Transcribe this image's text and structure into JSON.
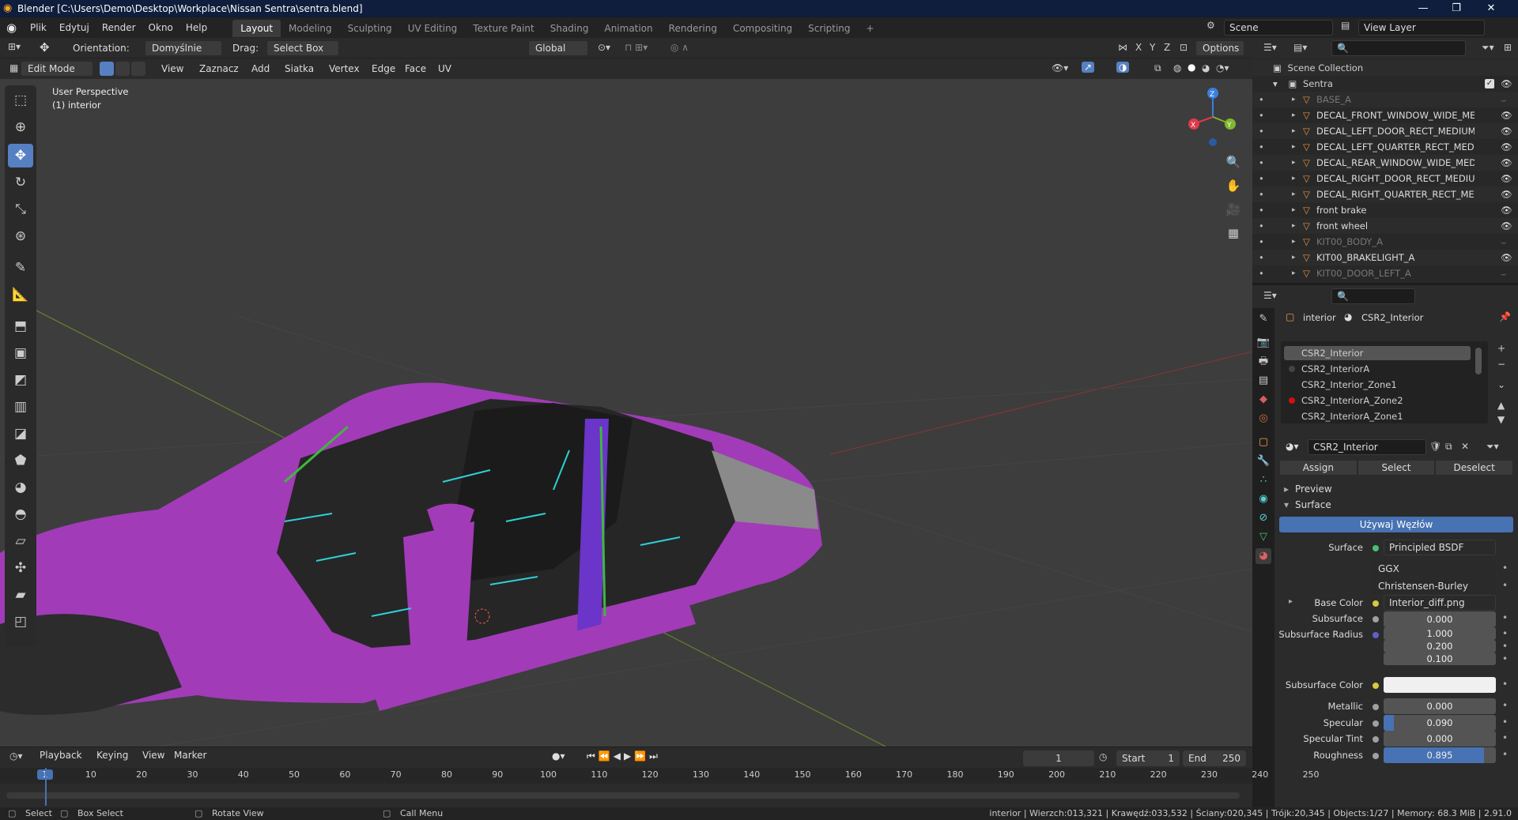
{
  "window": {
    "title": "Blender [C:\\Users\\Demo\\Desktop\\Workplace\\Nissan Sentra\\sentra.blend]"
  },
  "menu": [
    "Plik",
    "Edytuj",
    "Render",
    "Okno",
    "Help"
  ],
  "workspaces": [
    "Layout",
    "Modeling",
    "Sculpting",
    "UV Editing",
    "Texture Paint",
    "Shading",
    "Animation",
    "Rendering",
    "Compositing",
    "Scripting"
  ],
  "active_workspace": "Layout",
  "scene": {
    "name": "Scene",
    "view_layer": "View Layer"
  },
  "header": {
    "orientation_label": "Orientation:",
    "orientation_value": "Domyślnie",
    "drag_label": "Drag:",
    "drag_value": "Select Box",
    "transform_value": "Global",
    "axes": [
      "X",
      "Y",
      "Z"
    ],
    "options_label": "Options"
  },
  "mode_header": {
    "mode": "Edit Mode",
    "menus": [
      "View",
      "Zaznacz",
      "Add",
      "Siatka",
      "Vertex",
      "Edge",
      "Face",
      "UV"
    ]
  },
  "viewport": {
    "perspective": "User Perspective",
    "object": "(1) interior"
  },
  "gizmo": {
    "x": "X",
    "y": "Y",
    "z": "Z"
  },
  "outliner": {
    "scene_collection": "Scene Collection",
    "collection": "Sentra",
    "items": [
      {
        "name": "BASE_A",
        "dim": true
      },
      {
        "name": "DECAL_FRONT_WINDOW_WIDE_MEDIUI",
        "dim": false
      },
      {
        "name": "DECAL_LEFT_DOOR_RECT_MEDIUM_A",
        "dim": false
      },
      {
        "name": "DECAL_LEFT_QUARTER_RECT_MEDIUM_",
        "dim": false
      },
      {
        "name": "DECAL_REAR_WINDOW_WIDE_MEDIUM",
        "dim": false
      },
      {
        "name": "DECAL_RIGHT_DOOR_RECT_MEDIUM_A",
        "dim": false
      },
      {
        "name": "DECAL_RIGHT_QUARTER_RECT_MEDIUI",
        "dim": false
      },
      {
        "name": "front brake",
        "dim": false
      },
      {
        "name": "front wheel",
        "dim": false
      },
      {
        "name": "KIT00_BODY_A",
        "dim": true
      },
      {
        "name": "KIT00_BRAKELIGHT_A",
        "dim": false
      },
      {
        "name": "KIT00_DOOR_LEFT_A",
        "dim": true
      }
    ]
  },
  "properties": {
    "breadcrumb_object": "interior",
    "breadcrumb_material": "CSR2_Interior",
    "material_slots": [
      {
        "name": "CSR2_Interior",
        "color": "#555555",
        "selected": true
      },
      {
        "name": "CSR2_InteriorA",
        "color": "#444444",
        "selected": false
      },
      {
        "name": "CSR2_Interior_Zone1",
        "color": "#222222",
        "selected": false
      },
      {
        "name": "CSR2_InteriorA_Zone2",
        "color": "#d01010",
        "selected": false
      },
      {
        "name": "CSR2_InteriorA_Zone1",
        "color": "#222222",
        "selected": false
      }
    ],
    "material_name": "CSR2_Interior",
    "assign": "Assign",
    "select": "Select",
    "deselect": "Deselect",
    "preview": "Preview",
    "surface_panel": "Surface",
    "use_nodes": "Używaj Węzłów",
    "surface_label": "Surface",
    "surface_value": "Principled BSDF",
    "distribution": "GGX",
    "subsurface_method": "Christensen-Burley",
    "base_color_label": "Base Color",
    "base_color_value": "Interior_diff.png",
    "fields": [
      {
        "label": "Subsurface",
        "value": "0.000",
        "fill": 0
      },
      {
        "label": "Subsurface Radius",
        "value": "1.000",
        "fill": 0
      },
      {
        "label": "",
        "value": "0.200",
        "fill": 0
      },
      {
        "label": "",
        "value": "0.100",
        "fill": 0
      }
    ],
    "subsurface_color_label": "Subsurface Color",
    "fields2": [
      {
        "label": "Metallic",
        "value": "0.000",
        "fill": 0
      },
      {
        "label": "Specular",
        "value": "0.090",
        "fill": 0.09
      },
      {
        "label": "Specular Tint",
        "value": "0.000",
        "fill": 0
      },
      {
        "label": "Roughness",
        "value": "0.895",
        "fill": 0.895
      }
    ]
  },
  "timeline": {
    "menus": [
      "Playback",
      "Keying",
      "View",
      "Marker"
    ],
    "current_frame": "1",
    "start_label": "Start",
    "start": "1",
    "end_label": "End",
    "end": "250",
    "ticks": [
      "1",
      "10",
      "20",
      "30",
      "40",
      "50",
      "60",
      "70",
      "80",
      "90",
      "100",
      "110",
      "120",
      "130",
      "140",
      "150",
      "160",
      "170",
      "180",
      "190",
      "200",
      "210",
      "220",
      "230",
      "240",
      "250"
    ]
  },
  "status": {
    "select": "Select",
    "box_select": "Box Select",
    "rotate_view": "Rotate View",
    "call_menu": "Call Menu",
    "stats": "interior | Wierzch:013,321 | Krawędź:033,532 | Ściany:020,345 | Trójk:20,345 | Objects:1/27 | Memory: 68.3 MiB | 2.91.0"
  }
}
